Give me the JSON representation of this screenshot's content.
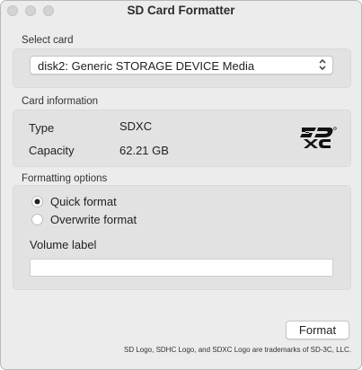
{
  "window": {
    "title": "SD Card Formatter"
  },
  "select_card": {
    "label": "Select card",
    "selected": "disk2: Generic STORAGE DEVICE Media"
  },
  "card_info": {
    "label": "Card information",
    "type_label": "Type",
    "type_value": "SDXC",
    "capacity_label": "Capacity",
    "capacity_value": "62.21 GB",
    "logo_icon": "sdxc-logo-icon"
  },
  "formatting": {
    "label": "Formatting options",
    "options": [
      {
        "label": "Quick format",
        "selected": true
      },
      {
        "label": "Overwrite format",
        "selected": false
      }
    ],
    "volume_label": "Volume label",
    "volume_value": ""
  },
  "actions": {
    "format_label": "Format"
  },
  "footer": {
    "text": "SD Logo, SDHC Logo, and SDXC Logo are trademarks of SD-3C, LLC."
  }
}
